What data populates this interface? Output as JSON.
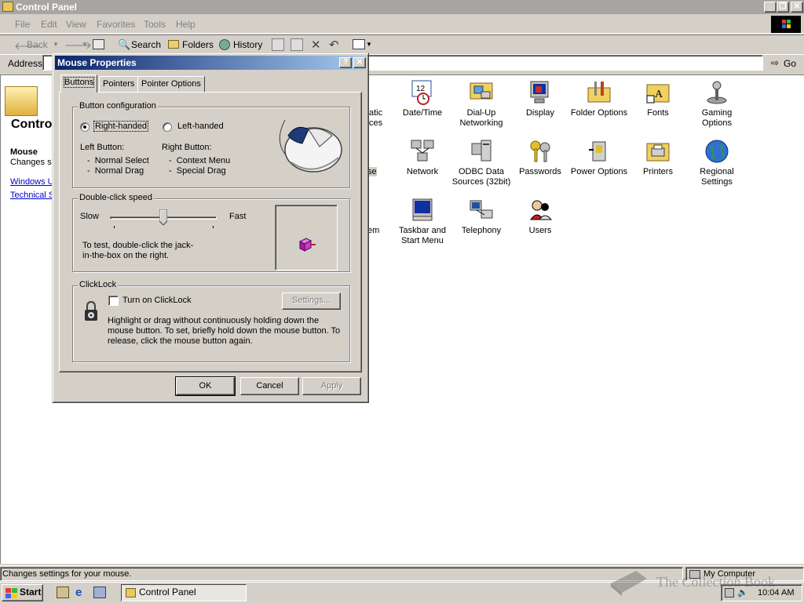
{
  "window": {
    "title": "Control Panel",
    "menus": [
      "File",
      "Edit",
      "View",
      "Favorites",
      "Tools",
      "Help"
    ],
    "toolbar": {
      "back": "Back",
      "search": "Search",
      "folders": "Folders",
      "history": "History"
    },
    "address": {
      "label": "Address",
      "go": "Go"
    },
    "left_panel": {
      "title": "Contro",
      "heading": "Mouse",
      "desc": "Changes se",
      "link1": "Windows U",
      "link2": "Technical S"
    },
    "partial_labels": [
      "atic",
      "ces",
      "se",
      "em"
    ],
    "icons": [
      {
        "label": "Date/Time",
        "icon": "calendar-clock-icon"
      },
      {
        "label": "Dial-Up Networking",
        "icon": "dialup-icon"
      },
      {
        "label": "Display",
        "icon": "display-icon"
      },
      {
        "label": "Folder Options",
        "icon": "folder-options-icon"
      },
      {
        "label": "Fonts",
        "icon": "fonts-icon"
      },
      {
        "label": "Gaming Options",
        "icon": "joystick-icon"
      },
      {
        "label": "Network",
        "icon": "network-icon"
      },
      {
        "label": "ODBC Data Sources (32bit)",
        "icon": "odbc-icon"
      },
      {
        "label": "Passwords",
        "icon": "keys-icon"
      },
      {
        "label": "Power Options",
        "icon": "power-icon"
      },
      {
        "label": "Printers",
        "icon": "printers-icon"
      },
      {
        "label": "Regional Settings",
        "icon": "globe-icon"
      },
      {
        "label": "Taskbar and Start Menu",
        "icon": "taskbar-icon"
      },
      {
        "label": "Telephony",
        "icon": "telephony-icon"
      },
      {
        "label": "Users",
        "icon": "users-icon"
      }
    ],
    "status_text": "Changes settings for your mouse.",
    "status_zone": "My Computer"
  },
  "dialog": {
    "title": "Mouse Properties",
    "tabs": [
      "Buttons",
      "Pointers",
      "Pointer Options"
    ],
    "button_config": {
      "label": "Button configuration",
      "right_handed": "Right-handed",
      "left_handed": "Left-handed",
      "selected": "right",
      "left_button_heading": "Left Button:",
      "left_button_items": [
        "Normal Select",
        "Normal Drag"
      ],
      "right_button_heading": "Right Button:",
      "right_button_items": [
        "Context Menu",
        "Special Drag"
      ]
    },
    "double_click": {
      "label": "Double-click speed",
      "slow": "Slow",
      "fast": "Fast",
      "speed": 0.5,
      "instructions": "To test, double-click the jack-in-the-box on the right."
    },
    "clicklock": {
      "label": "ClickLock",
      "checkbox": "Turn on ClickLock",
      "checked": false,
      "settings": "Settings...",
      "description": "Highlight or drag without continuously holding down the mouse button. To set, briefly hold down the mouse button. To release, click the mouse button again."
    },
    "buttons": {
      "ok": "OK",
      "cancel": "Cancel",
      "apply": "Apply"
    }
  },
  "taskbar": {
    "start": "Start",
    "task": "Control Panel",
    "clock": "10:04 AM"
  },
  "watermark": "The Collection Book",
  "colors": {
    "title_active_start": "#0a246a",
    "title_active_end": "#a6caf0",
    "title_inactive": "#a7a6a4",
    "face": "#d4d0c8"
  }
}
